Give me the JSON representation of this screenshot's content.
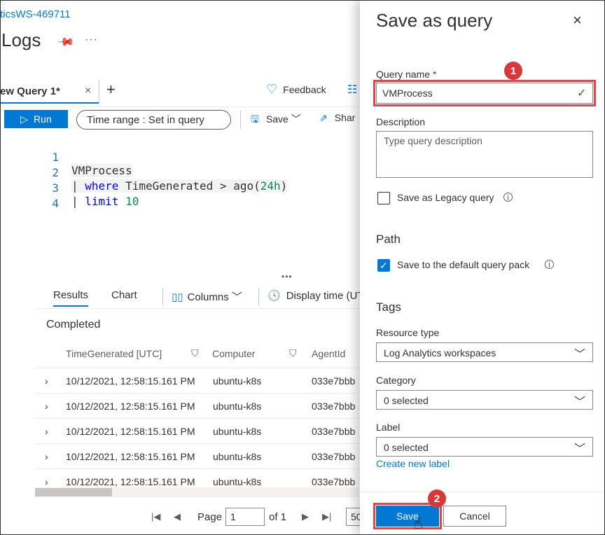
{
  "breadcrumb": {
    "workspace": "ticsWS-469711"
  },
  "page": {
    "title": "Logs",
    "more": "···"
  },
  "tabs": {
    "active_label": "ew Query 1*",
    "close": "×",
    "add": "+"
  },
  "header_actions": {
    "feedback": "Feedback"
  },
  "toolbar": {
    "run": "Run",
    "time_range": "Time range :  Set in query",
    "save": "Save",
    "share": "Shar"
  },
  "editor": {
    "lines": [
      {
        "num": "1",
        "text": "VMProcess"
      },
      {
        "num": "2",
        "pipe": "| ",
        "kw": "where",
        "rest": " TimeGenerated > ago(",
        "num_lit": "24h",
        "close": ")"
      },
      {
        "num": "3",
        "pipe": "| ",
        "kw": "limit",
        "rest": " ",
        "num_lit": "10"
      },
      {
        "num": "4"
      }
    ]
  },
  "results": {
    "tabs": {
      "results": "Results",
      "chart": "Chart",
      "columns": "Columns",
      "display_time": "Display time (UT"
    },
    "status": "Completed",
    "columns": [
      "TimeGenerated [UTC]",
      "Computer",
      "AgentId"
    ],
    "rows": [
      {
        "time": "10/12/2021, 12:58:15.161 PM",
        "computer": "ubuntu-k8s",
        "agent": "033e7bbb"
      },
      {
        "time": "10/12/2021, 12:58:15.161 PM",
        "computer": "ubuntu-k8s",
        "agent": "033e7bbb"
      },
      {
        "time": "10/12/2021, 12:58:15.161 PM",
        "computer": "ubuntu-k8s",
        "agent": "033e7bbb"
      },
      {
        "time": "10/12/2021, 12:58:15.161 PM",
        "computer": "ubuntu-k8s",
        "agent": "033e7bbb"
      },
      {
        "time": "10/12/2021, 12:58:15.161 PM",
        "computer": "ubuntu-k8s",
        "agent": "033e7bbb"
      }
    ],
    "pager": {
      "page_label": "Page",
      "page_value": "1",
      "of_label": "of 1",
      "page_size": "50"
    }
  },
  "panel": {
    "title": "Save as query",
    "close": "×",
    "query_name_label": "Query name",
    "required_mark": "*",
    "query_name_value": "VMProcess",
    "description_label": "Description",
    "description_placeholder": "Type query description",
    "legacy_label": "Save as Legacy query",
    "legacy_checked": false,
    "path_title": "Path",
    "default_pack_label": "Save to the default query pack",
    "default_pack_checked": true,
    "tags_title": "Tags",
    "resource_type_label": "Resource type",
    "resource_type_value": "Log Analytics workspaces",
    "category_label": "Category",
    "category_value": "0 selected",
    "label_label": "Label",
    "label_value": "0 selected",
    "create_label": "Create new label",
    "save_button": "Save",
    "cancel_button": "Cancel"
  },
  "callouts": {
    "one": "1",
    "two": "2"
  },
  "colors": {
    "accent": "#0078d4",
    "callout": "#d9383b",
    "highlight_border": "#e0474c",
    "success": "#107c10"
  }
}
